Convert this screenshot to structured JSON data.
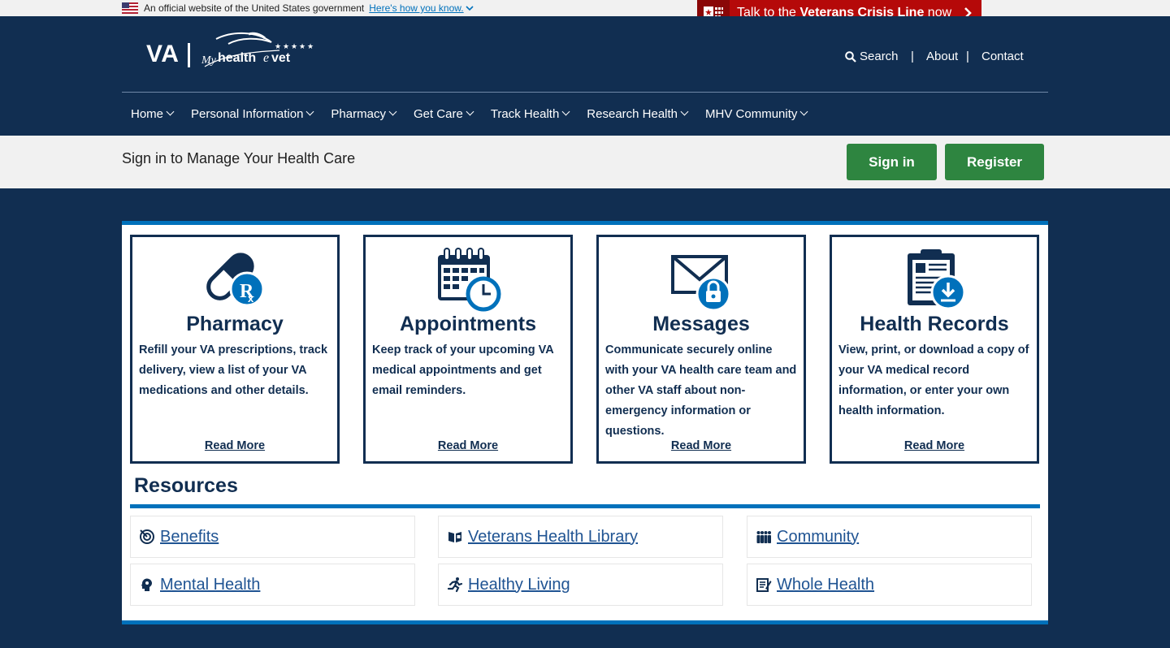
{
  "gov_banner": {
    "text": "An official website of the United States government",
    "link": "Here's how you know."
  },
  "crisis": {
    "prefix": "Talk to the ",
    "bold": "Veterans Crisis Line",
    "suffix": " now"
  },
  "logo": {
    "va": "VA"
  },
  "utility": {
    "search": "Search",
    "about": "About",
    "contact": "Contact",
    "separator": "|"
  },
  "nav": [
    {
      "label": "Home"
    },
    {
      "label": "Personal Information"
    },
    {
      "label": "Pharmacy"
    },
    {
      "label": "Get Care"
    },
    {
      "label": "Track Health"
    },
    {
      "label": "Research Health"
    },
    {
      "label": "MHV Community"
    }
  ],
  "signin": {
    "text": "Sign in to Manage Your Health Care",
    "signin_label": "Sign in",
    "register_label": "Register"
  },
  "cards": [
    {
      "title": "Pharmacy",
      "desc": "Refill your VA prescriptions, track delivery, view a list of your VA medications and other details.",
      "link": "Read More",
      "icon": "pill-rx-icon"
    },
    {
      "title": "Appointments",
      "desc": "Keep track of your upcoming VA medical appointments and get email reminders.",
      "link": "Read More",
      "icon": "calendar-clock-icon"
    },
    {
      "title": "Messages",
      "desc": "Communicate securely online with your VA health care team and other VA staff about non-emergency information or questions.",
      "link": "Read More",
      "icon": "envelope-lock-icon"
    },
    {
      "title": "Health Records",
      "desc": "View, print, or download a copy of your VA medical record information, or enter your own health information.",
      "link": "Read More",
      "icon": "document-download-icon"
    }
  ],
  "resources": {
    "title": "Resources",
    "items": [
      {
        "label": "Benefits",
        "icon": "target-icon"
      },
      {
        "label": "Veterans Health Library",
        "icon": "book-icon"
      },
      {
        "label": "Community",
        "icon": "people-icon"
      },
      {
        "label": "Mental Health",
        "icon": "head-icon"
      },
      {
        "label": "Healthy Living",
        "icon": "runner-icon"
      },
      {
        "label": "Whole Health",
        "icon": "notepad-icon"
      }
    ]
  },
  "colors": {
    "navy": "#112e51",
    "blue": "#0071bb",
    "green": "#2e8540",
    "crisis_red": "#b50909",
    "link": "#205493"
  }
}
